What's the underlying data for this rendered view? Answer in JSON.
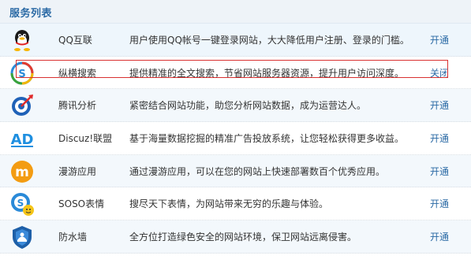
{
  "header": {
    "title": "服务列表"
  },
  "services": [
    {
      "icon": "qq-penguin-icon",
      "name": "QQ互联",
      "description": "用户使用QQ帐号一键登录网站，大大降低用户注册、登录的门槛。",
      "status": "开通"
    },
    {
      "icon": "soso-search-icon",
      "name": "纵横搜索",
      "description": "提供精准的全文搜索，节省网站服务器资源，提升用户访问深度。",
      "status": "关闭"
    },
    {
      "icon": "analytics-target-icon",
      "name": "腾讯分析",
      "description": "紧密结合网站功能，助您分析网站数据，成为运营达人。",
      "status": "开通"
    },
    {
      "icon": "ad-logo-icon",
      "name": "Discuz!联盟",
      "description": "基于海量数据挖掘的精准广告投放系统，让您轻松获得更多收益。",
      "status": "开通"
    },
    {
      "icon": "manyou-m-icon",
      "name": "漫游应用",
      "description": "通过漫游应用，可以在您的网站上快速部署数百个优秀应用。",
      "status": "开通"
    },
    {
      "icon": "soso-emoticon-icon",
      "name": "SOSO表情",
      "description": "搜尽天下表情，为网站带来无穷的乐趣与体验。",
      "status": "开通"
    },
    {
      "icon": "firewall-shield-icon",
      "name": "防水墙",
      "description": "全方位打造绿色安全的网站环境，保卫网站远离侵害。",
      "status": "开通"
    }
  ],
  "colors": {
    "link": "#2b6aa5",
    "highlight_border": "#d93030",
    "header_bg": "#eef3f8"
  }
}
